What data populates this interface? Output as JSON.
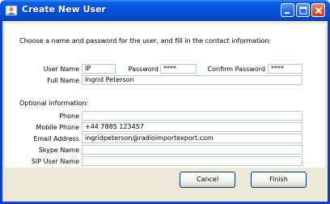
{
  "window": {
    "title": "Create New User",
    "title_icon": "user-icon",
    "controls": [
      "minimize-icon",
      "maximize-icon",
      "close-icon"
    ]
  },
  "intro_text": "Choose a name and password for the user, and fill in the contact information:",
  "fields": {
    "user_name": {
      "label": "User Name",
      "value": "IP"
    },
    "password": {
      "label": "Password",
      "value": "****"
    },
    "confirm_password": {
      "label": "Confirm Password",
      "value": "****"
    },
    "full_name": {
      "label": "Full Name",
      "value": "Ingrid Peterson"
    }
  },
  "optional": {
    "heading": "Optional information:",
    "phone": {
      "label": "Phone",
      "value": ""
    },
    "mobile_phone": {
      "label": "Mobile Phone",
      "value": "+44 7885 123457"
    },
    "email_address": {
      "label": "Email Address",
      "value": "ingridpeterson@radioimportexport.com"
    },
    "skype_name": {
      "label": "Skype Name",
      "value": ""
    },
    "sip_user_name": {
      "label": "SIP User Name",
      "value": ""
    }
  },
  "buttons": {
    "cancel": "Cancel",
    "finish": "Finish"
  },
  "colors": {
    "titlebar": "#0452d8",
    "window_frame": "#0a3fd0",
    "dialog_bg": "#ece9d8",
    "close_button": "#e0542a"
  }
}
